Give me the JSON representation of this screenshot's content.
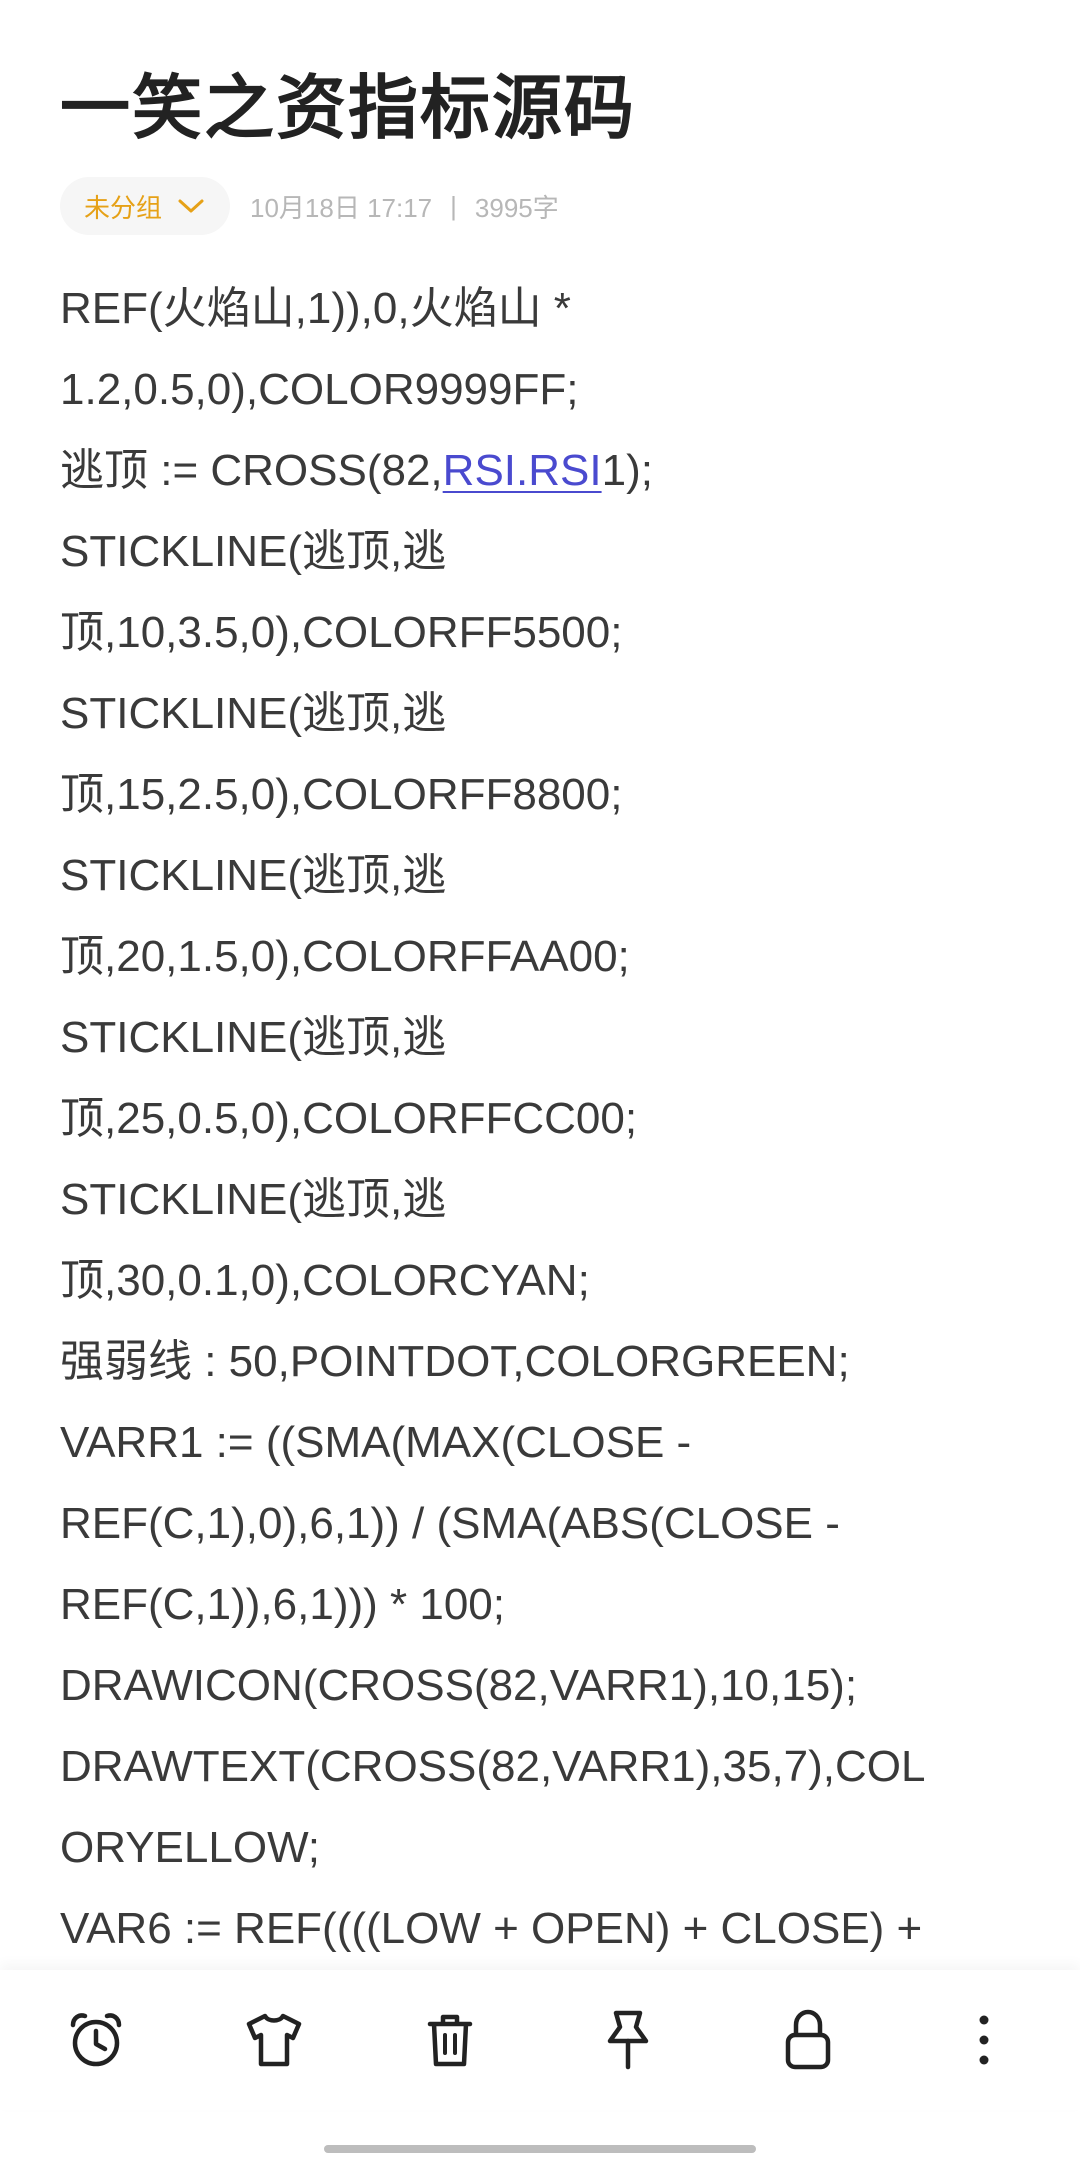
{
  "note": {
    "title": "一笑之资指标源码",
    "group_label": "未分组",
    "date": "10月18日 17:17",
    "separator": "|",
    "word_count": "3995字"
  },
  "content": {
    "lines": [
      "REF(火焰山,1)),0,火焰山 *",
      "1.2,0.5,0),COLOR9999FF;",
      "逃顶 := CROSS(82,",
      "STICKLINE(逃顶,逃",
      "顶,10,3.5,0),COLORFF5500;",
      "STICKLINE(逃顶,逃",
      "顶,15,2.5,0),COLORFF8800;",
      "STICKLINE(逃顶,逃",
      "顶,20,1.5,0),COLORFFAA00;",
      "STICKLINE(逃顶,逃",
      "顶,25,0.5,0),COLORFFCC00;",
      "STICKLINE(逃顶,逃",
      "顶,30,0.1,0),COLORCYAN;",
      "强弱线 : 50,POINTDOT,COLORGREEN;",
      "VARR1 := ((SMA(MAX(CLOSE -",
      "REF(C,1),0),6,1)) / (SMA(ABS(CLOSE -",
      "REF(C,1)),6,1))) * 100;",
      "DRAWICON(CROSS(82,VARR1),10,15);",
      "DRAWTEXT(CROSS(82,VARR1),35,7),COL",
      "ORYELLOW;",
      "VAR6 := REF((((LOW + OPEN) + CLOSE) +"
    ],
    "link_text": "RSI.RSI",
    "line3_suffix": "1);"
  },
  "toolbar": {
    "icons": [
      "alarm-clock-icon",
      "t-shirt-icon",
      "trash-icon",
      "pin-icon",
      "lock-icon",
      "more-vertical-icon"
    ]
  },
  "colors": {
    "accent": "#e6a117",
    "link": "#4a4acf",
    "text": "#3a3a3a",
    "meta": "#b7b7b7"
  }
}
